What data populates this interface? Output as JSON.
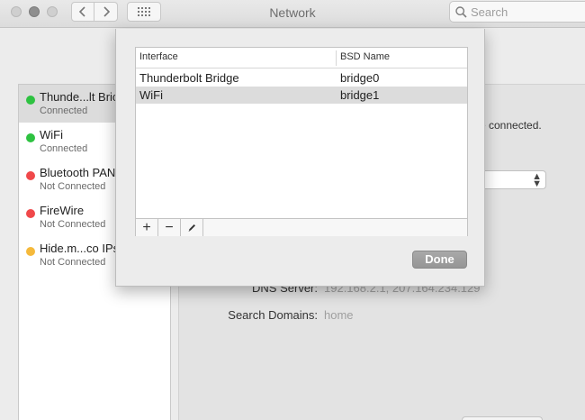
{
  "window": {
    "title": "Network"
  },
  "toolbar": {
    "back_icon": "chevron-left-icon",
    "forward_icon": "chevron-right-icon",
    "show_all_icon": "grid-icon",
    "search_placeholder": "Search"
  },
  "sidebar": {
    "services": [
      {
        "name": "Thunde...lt Bric",
        "status": "Connected",
        "status_color": "#2ec241",
        "selected": true
      },
      {
        "name": "WiFi",
        "status": "Connected",
        "status_color": "#2ec241",
        "selected": false
      },
      {
        "name": "Bluetooth PAN",
        "status": "Not Connected",
        "status_color": "#f0484a",
        "selected": false
      },
      {
        "name": "FireWire",
        "status": "Not Connected",
        "status_color": "#f0484a",
        "selected": false
      },
      {
        "name": "Hide.m...co IPs",
        "status": "Not Connected",
        "status_color": "#f5b93b",
        "selected": false
      }
    ]
  },
  "detail": {
    "status_text": "e connected.",
    "dns_label": "DNS Server:",
    "dns_value": "192.168.2.1, 207.164.234.129",
    "search_domains_label": "Search Domains:",
    "search_domains_value": "home"
  },
  "sheet": {
    "columns": {
      "interface": "Interface",
      "bsd_name": "BSD Name"
    },
    "rows": [
      {
        "interface": "Thunderbolt Bridge",
        "bsd_name": "bridge0",
        "selected": false
      },
      {
        "interface": "WiFi",
        "bsd_name": "bridge1",
        "selected": true
      }
    ],
    "add_label": "+",
    "remove_label": "−",
    "edit_icon": "pencil-icon",
    "done_label": "Done"
  }
}
